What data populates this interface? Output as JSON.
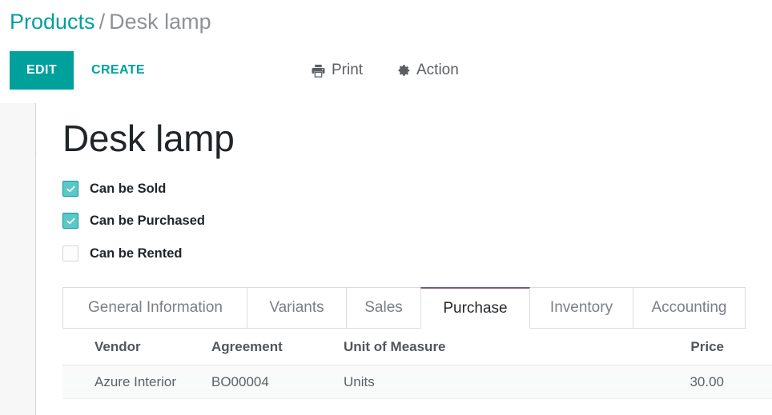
{
  "breadcrumb": {
    "root": "Products",
    "separator": "/",
    "current": "Desk lamp"
  },
  "toolbar": {
    "edit_label": "EDIT",
    "create_label": "CREATE",
    "print_label": "Print",
    "action_label": "Action",
    "print_icon": "printer-icon",
    "action_icon": "gear-icon"
  },
  "record": {
    "title": "Desk lamp",
    "checkboxes": [
      {
        "label": "Can be Sold",
        "checked": true
      },
      {
        "label": "Can be Purchased",
        "checked": true
      },
      {
        "label": "Can be Rented",
        "checked": false
      }
    ]
  },
  "tabs": [
    {
      "label": "General Information",
      "active": false
    },
    {
      "label": "Variants",
      "active": false
    },
    {
      "label": "Sales",
      "active": false
    },
    {
      "label": "Purchase",
      "active": true
    },
    {
      "label": "Inventory",
      "active": false
    },
    {
      "label": "Accounting",
      "active": false
    }
  ],
  "table": {
    "columns": [
      "Vendor",
      "Agreement",
      "Unit of Measure",
      "Price"
    ],
    "rows": [
      {
        "vendor": "Azure Interior",
        "agreement": "BO00004",
        "uom": "Units",
        "price": "30.00"
      }
    ]
  },
  "colors": {
    "accent_teal": "#00a09d",
    "checkbox_fill": "#5ac8c8",
    "active_tab_border": "#7d5a72",
    "muted_text": "#8f9295"
  }
}
